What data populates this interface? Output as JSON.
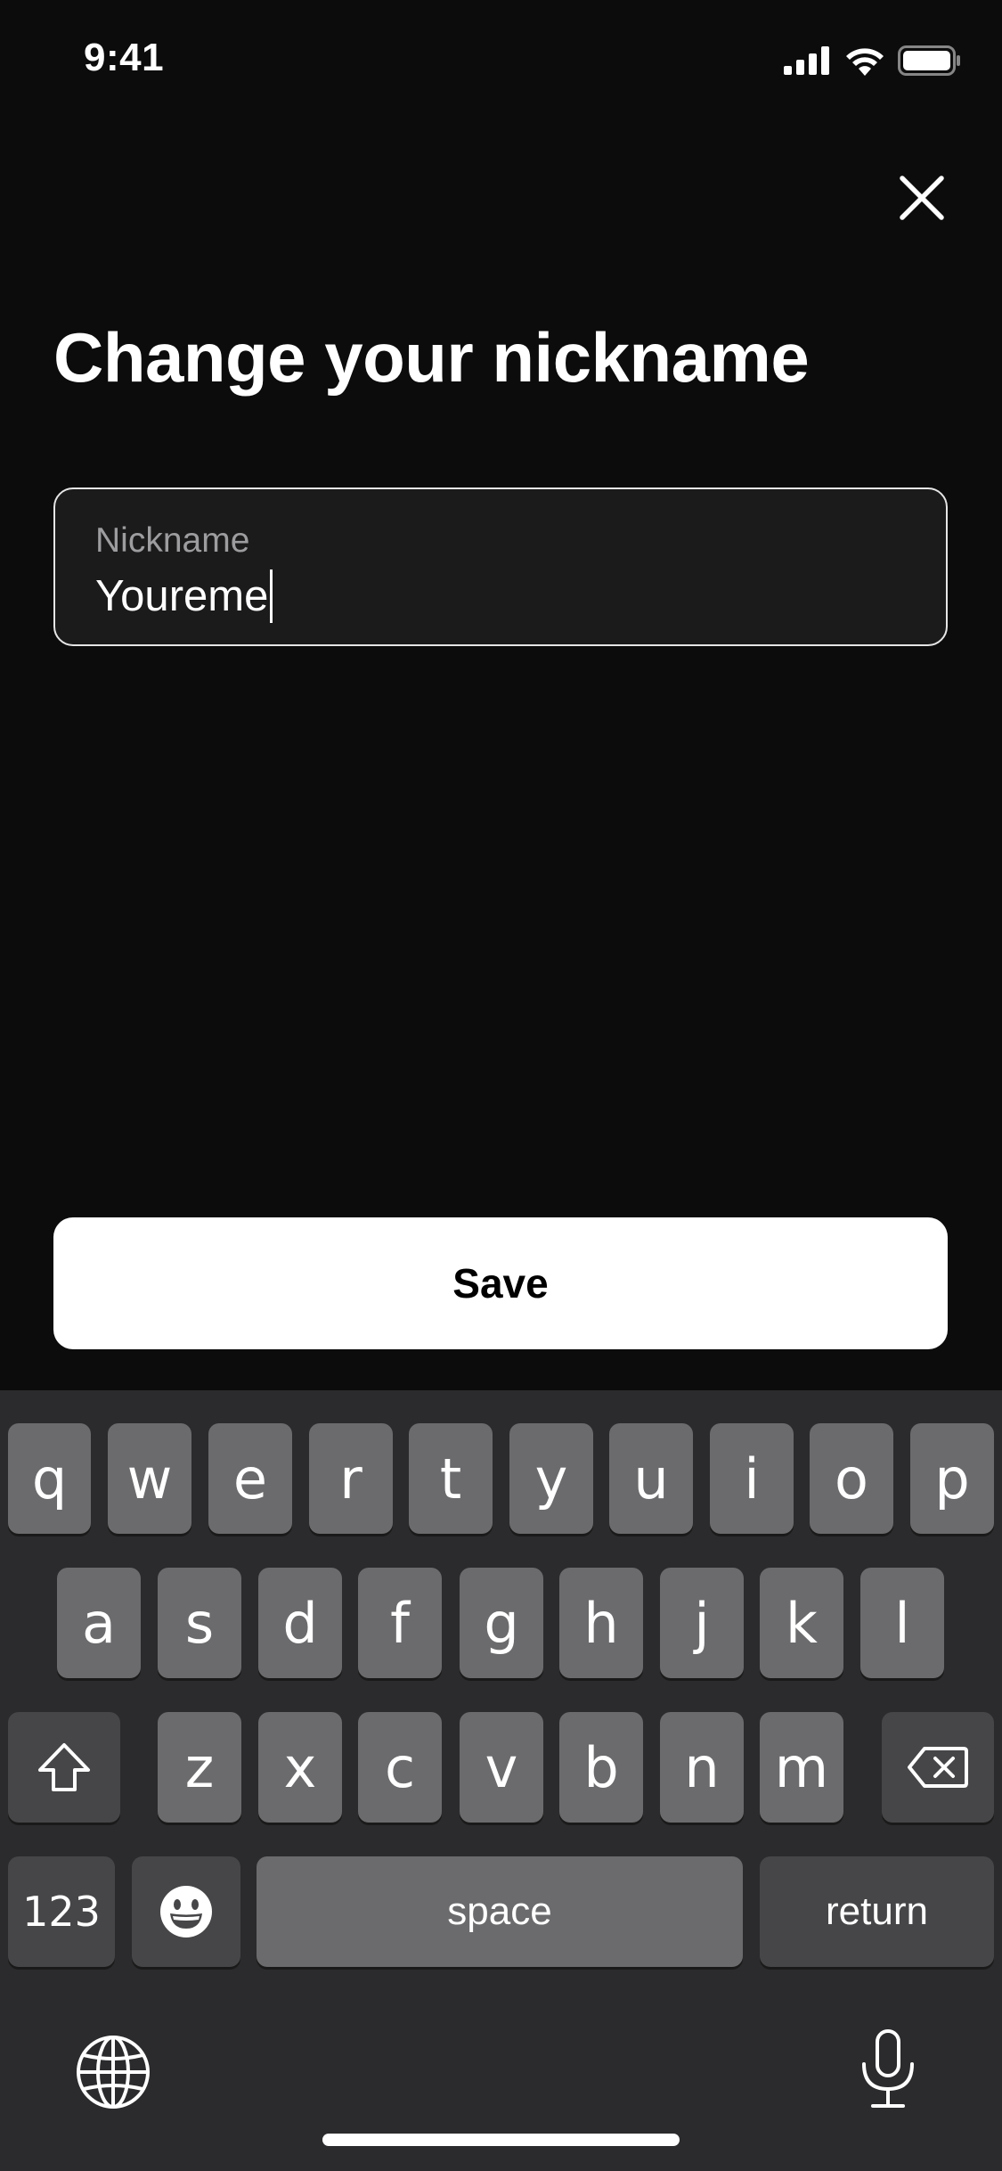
{
  "status_bar": {
    "time": "9:41"
  },
  "page": {
    "title": "Change your nickname"
  },
  "nickname_field": {
    "label": "Nickname",
    "value": "Youreme"
  },
  "save_button": {
    "label": "Save"
  },
  "keyboard": {
    "row1": [
      "q",
      "w",
      "e",
      "r",
      "t",
      "y",
      "u",
      "i",
      "o",
      "p"
    ],
    "row2": [
      "a",
      "s",
      "d",
      "f",
      "g",
      "h",
      "j",
      "k",
      "l"
    ],
    "row3": [
      "z",
      "x",
      "c",
      "v",
      "b",
      "n",
      "m"
    ],
    "numbers_label": "123",
    "space_label": "space",
    "return_label": "return"
  },
  "icons": {
    "close": "close-icon",
    "shift": "shift-icon",
    "backspace": "backspace-icon",
    "emoji": "emoji-icon",
    "globe": "globe-icon",
    "microphone": "microphone-icon"
  },
  "colors": {
    "background": "#0c0c0d",
    "keyboard": "#2b2b2d",
    "key": "#6b6b6d",
    "key_dark": "#464648"
  }
}
